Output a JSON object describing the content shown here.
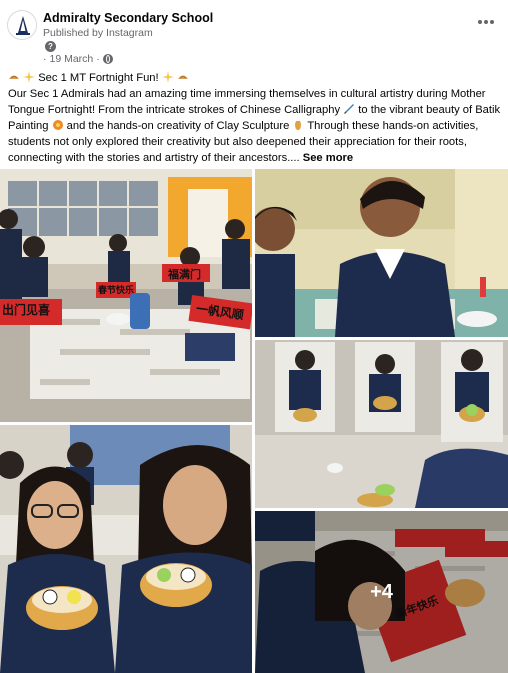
{
  "post": {
    "page_name": "Admiralty Secondary School",
    "published_via": "Published by Instagram",
    "date": "19 March",
    "date_separator": "·",
    "more_icon": "ellipsis-icon",
    "privacy_icon": "globe-icon",
    "text": {
      "line1": "Sec 1 MT Fortnight Fun!",
      "body_a": "Our Sec 1 Admirals  had an amazing time immersing themselves in cultural artistry during Mother Tongue Fortnight! From the intricate strokes of Chinese Calligraphy",
      "body_b": "to the vibrant beauty of Batik Painting",
      "body_c": "and the hands-on creativity of Clay Sculpture",
      "body_d": "Through these hands-on activities, students not only explored their creativity but also deepened their appreciation for their roots, connecting with the stories and artistry of their ancestors....",
      "see_more": "See more"
    }
  },
  "photos": {
    "more_count": "+4",
    "calligraphy_left_1": "出门见喜",
    "calligraphy_left_2": "春节快乐",
    "calligraphy_mid": "福满门",
    "calligraphy_right": "一帆风顺",
    "calligraphy_bottom": "新年快乐"
  }
}
